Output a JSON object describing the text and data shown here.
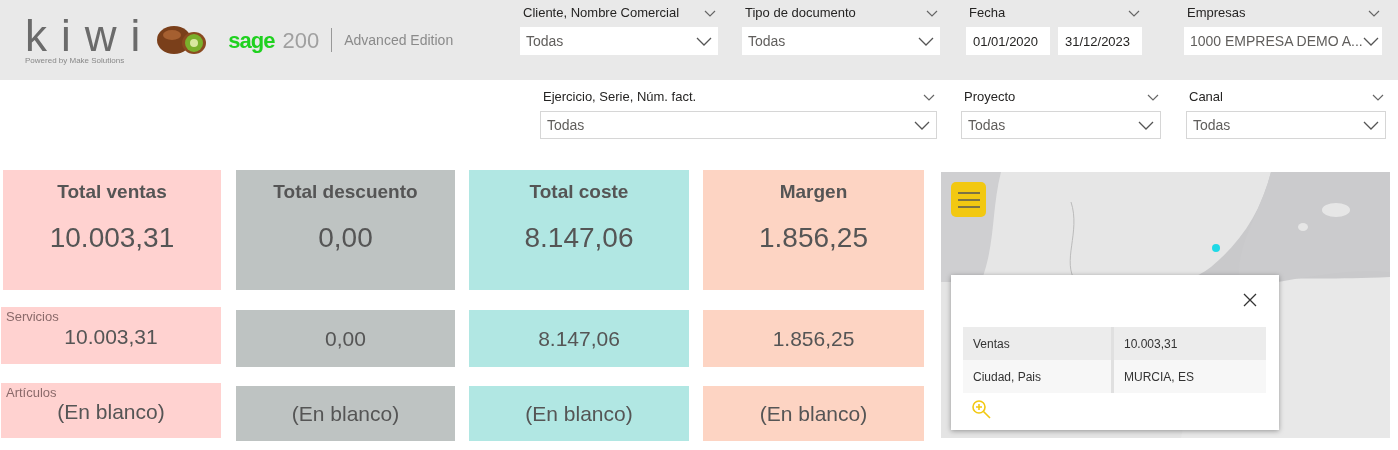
{
  "header": {
    "logo": {
      "name": "kiwi",
      "tagline": "Powered by Make Solutions"
    },
    "product": {
      "brand": "sage",
      "version": "200",
      "edition": "Advanced Edition"
    }
  },
  "filters_top": [
    {
      "kind": "dropdown",
      "label": "Cliente, Nombre Comercial",
      "value": "Todas"
    },
    {
      "kind": "dropdown",
      "label": "Tipo de documento",
      "value": "Todas"
    },
    {
      "kind": "daterange",
      "label": "Fecha",
      "from": "01/01/2020",
      "to": "31/12/2023"
    },
    {
      "kind": "dropdown",
      "label": "Empresas",
      "value": "1000 EMPRESA DEMO A..."
    }
  ],
  "filters_bottom": [
    {
      "kind": "dropdown",
      "label": "Ejercicio, Serie, Núm. fact.",
      "value": "Todas"
    },
    {
      "kind": "dropdown",
      "label": "Proyecto",
      "value": "Todas"
    },
    {
      "kind": "dropdown",
      "label": "Canal",
      "value": "Todas"
    }
  ],
  "metrics": [
    {
      "title": "Total ventas",
      "value": "10.003,31",
      "color": "#ffd2d0"
    },
    {
      "title": "Total descuento",
      "value": "0,00",
      "color": "#bec3c2"
    },
    {
      "title": "Total coste",
      "value": "8.147,06",
      "color": "#b1e7e3"
    },
    {
      "title": "Margen",
      "value": "1.856,25",
      "color": "#fdd4c3"
    }
  ],
  "breakdown": [
    {
      "label": "Servicios",
      "values": [
        "10.003,31",
        "0,00",
        "8.147,06",
        "1.856,25"
      ]
    },
    {
      "label": "Artículos",
      "values": [
        "(En blanco)",
        "(En blanco)",
        "(En blanco)",
        "(En blanco)"
      ]
    }
  ],
  "map": {
    "popup": {
      "rows": [
        {
          "field": "Ventas",
          "value": "10.003,31"
        },
        {
          "field": "Ciudad, Pais",
          "value": "MURCIA, ES"
        }
      ]
    }
  }
}
